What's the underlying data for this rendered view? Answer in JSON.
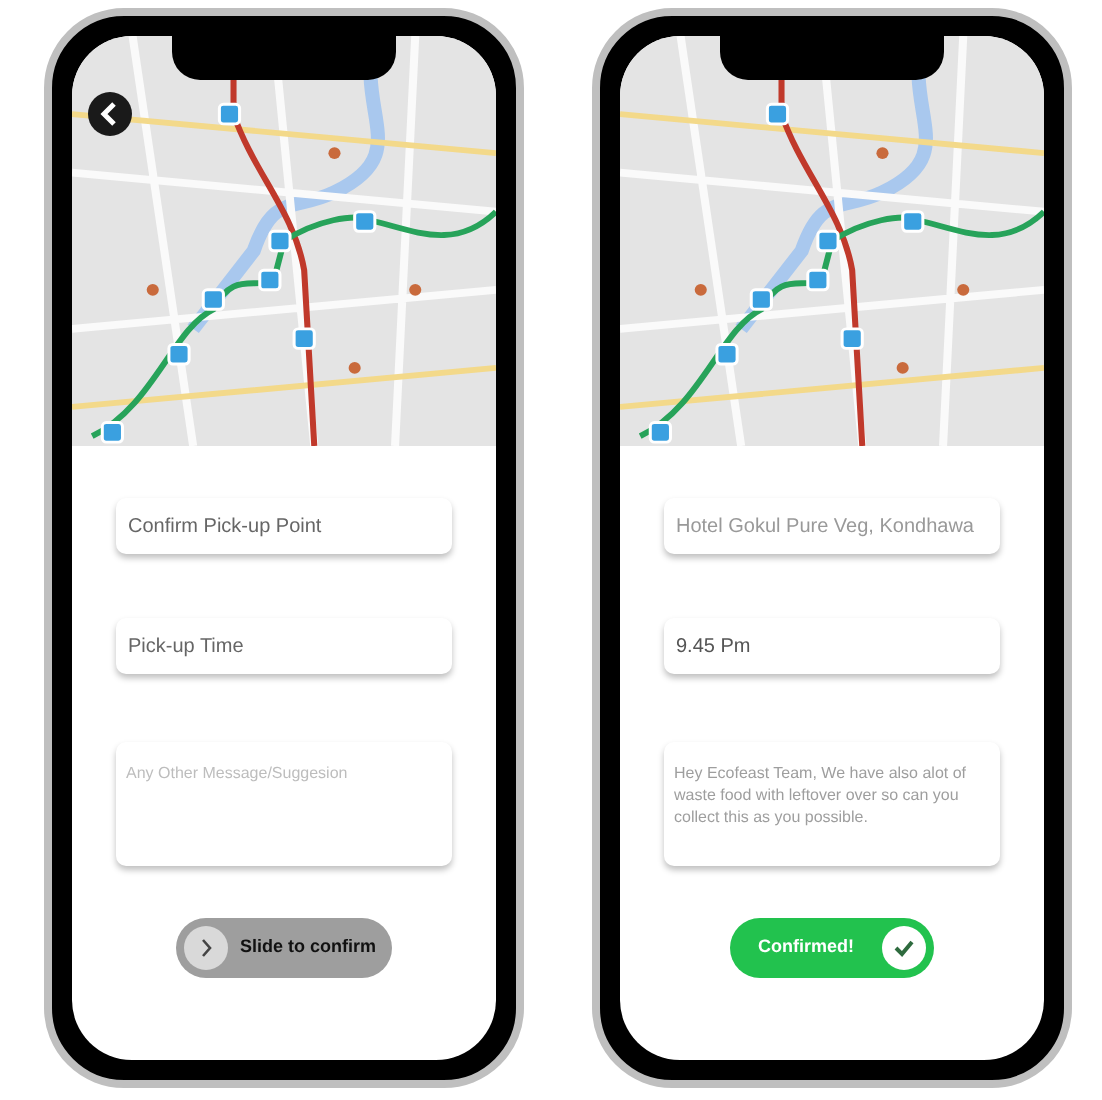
{
  "phones": [
    {
      "back_button": true,
      "fields": [
        {
          "kind": "input",
          "placeholder": "Confirm Pick-up Point"
        },
        {
          "kind": "input",
          "placeholder": "Pick-up Time"
        },
        {
          "kind": "textarea",
          "placeholder": "Any Other Message/Suggesion"
        }
      ],
      "slider": {
        "label": "Slide to confirm",
        "confirmed": false
      }
    },
    {
      "back_button": false,
      "fields": [
        {
          "kind": "input",
          "value": "Hotel Gokul Pure Veg, Kondhawa"
        },
        {
          "kind": "input",
          "value": "9.45 Pm"
        },
        {
          "kind": "textarea",
          "value": "Hey Ecofeast Team, We have also alot of waste food with leftover over so can you collect this as you possible."
        }
      ],
      "slider": {
        "label": "Confirmed!",
        "confirmed": true
      }
    }
  ]
}
